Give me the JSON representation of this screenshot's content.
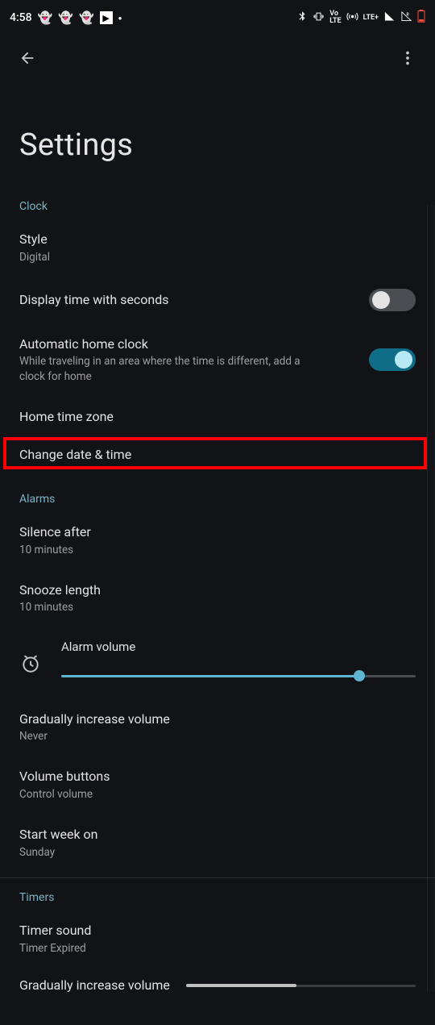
{
  "status": {
    "time": "4:58",
    "lte": "LTE+"
  },
  "page": {
    "title": "Settings"
  },
  "sections": {
    "clock": {
      "header": "Clock",
      "style_title": "Style",
      "style_value": "Digital",
      "seconds_title": "Display time with seconds",
      "seconds_on": false,
      "autohome_title": "Automatic home clock",
      "autohome_desc": "While traveling in an area where the time is different, add a clock for home",
      "autohome_on": true,
      "home_tz_title": "Home time zone",
      "change_dt_title": "Change date & time"
    },
    "alarms": {
      "header": "Alarms",
      "silence_title": "Silence after",
      "silence_value": "10 minutes",
      "snooze_title": "Snooze length",
      "snooze_value": "10 minutes",
      "volume_label": "Alarm volume",
      "volume_percent": 84,
      "grad_title": "Gradually increase volume",
      "grad_value": "Never",
      "volbtn_title": "Volume buttons",
      "volbtn_value": "Control volume",
      "startweek_title": "Start week on",
      "startweek_value": "Sunday"
    },
    "timers": {
      "header": "Timers",
      "sound_title": "Timer sound",
      "sound_value": "Timer Expired",
      "grad_title": "Gradually increase volume",
      "grad_percent": 48
    }
  }
}
